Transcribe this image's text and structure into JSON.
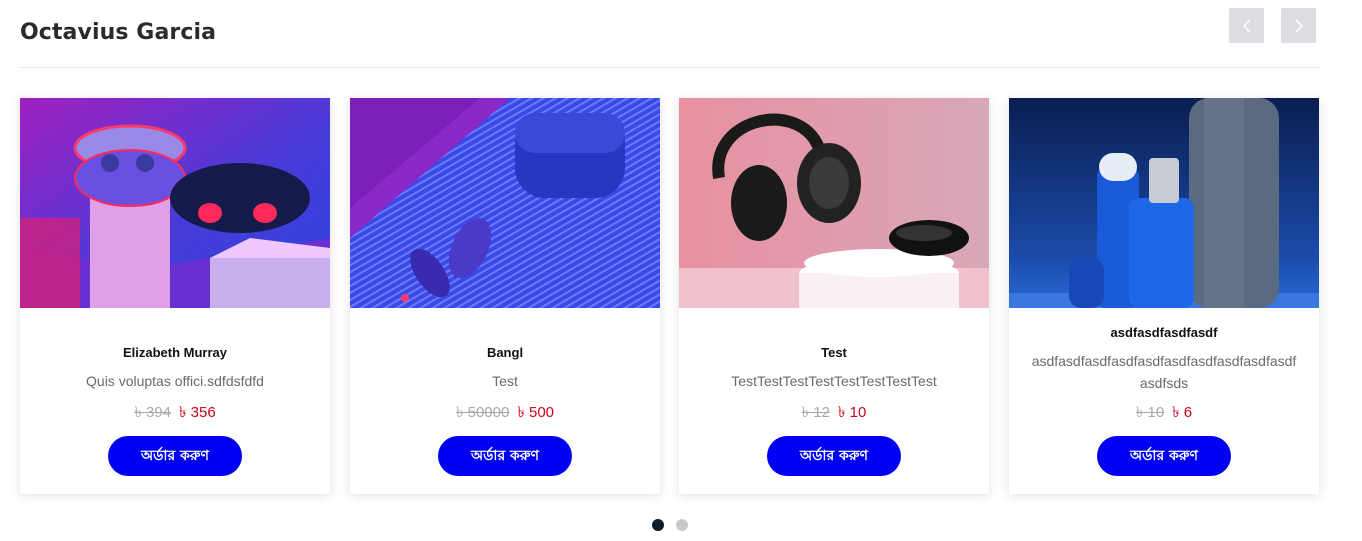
{
  "section": {
    "title": "Octavius Garcia"
  },
  "nav": {
    "prev_icon": "chevron-left-icon",
    "next_icon": "chevron-right-icon"
  },
  "products": [
    {
      "name": "Elizabeth Murray",
      "description": "Quis voluptas offici.sdfdsfdfd",
      "old_price": "৳ 394",
      "new_price": "৳ 356",
      "button": "অর্ডার করুণ",
      "image": "earbuds-case-neon"
    },
    {
      "name": "Bangl",
      "description": "Test",
      "old_price": "৳ 50000",
      "new_price": "৳ 500",
      "button": "অর্ডার করুণ",
      "image": "earbuds-blue-carbon"
    },
    {
      "name": "Test",
      "description": "TestTestTestTestTestTestTestTest",
      "old_price": "৳ 12",
      "new_price": "৳ 10",
      "button": "অর্ডার করুণ",
      "image": "headphones-pink"
    },
    {
      "name": "asdfasdfasdfasdf",
      "description": "asdfasdfasdfasdfasdfasdfasdfasdfasdfasdfasdfsds",
      "old_price": "৳ 10",
      "new_price": "৳ 6",
      "button": "অর্ডার করুণ",
      "image": "cosmetics-blue"
    }
  ],
  "pagination": {
    "pages": 2,
    "active": 1
  },
  "colors": {
    "accent": "#0000f2",
    "price": "#d0021b",
    "dot_active": "#0d1b2a"
  }
}
